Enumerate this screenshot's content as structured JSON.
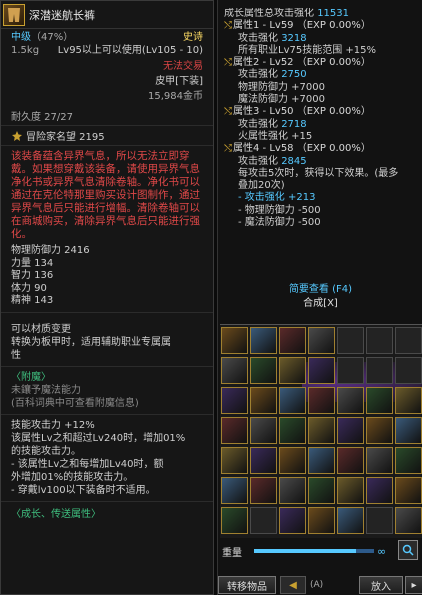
{
  "tooltip": {
    "item_name": "深潜迷航长裤",
    "grade": "中级",
    "grade_pct": "（47%）",
    "rarity": "史诗",
    "weight": "1.5kg",
    "level_req": "Lv95以上可以使用(Lv105 - 10)",
    "trade": "无法交易",
    "type": "皮甲[下装]",
    "price": "15,984金币",
    "durability": "耐久度 27/27",
    "fame": "冒险家名望 2195",
    "warning": "该装备蕴含异界气息，所以无法立即穿戴。如果想穿戴该装备，请使用异界气息净化书或异界气息清除卷轴。净化书可以通过在克伦特那里购买设计图制作，通过异界气息后只能进行增幅。清除卷轴可以在商城购买，清除异界气息后只能进行强化。",
    "stats": [
      "物理防御力 2416",
      "力量 134",
      "智力 136",
      "体力 90",
      "精神 143"
    ],
    "transfer": [
      "可以材质变更",
      "转换为板甲时，适用辅助职业专属属",
      "性"
    ],
    "enchant": [
      "〈附魔〉",
      "未鑲予魔法能力",
      "(百科词典中可查看附魔信息)"
    ],
    "skills": [
      "技能攻击力 +12%",
      "该属性Lv之和超过Lv240时，增加01%",
      "的技能攻击力。",
      " - 该属性Lv之和每增加Lv40时，额",
      "外增加01%的技能攻击力。",
      " - 穿戴lv100以下装备时不适用。"
    ],
    "footer": "〈成长、传送属性〉"
  },
  "growth": {
    "title": "成长属性总攻击强化",
    "title_value": "11531",
    "attrs": [
      {
        "head": "属性1 - Lv59 （EXP 0.00%）",
        "atk_label": "攻击强化",
        "atk": "3218",
        "lines": [
          "所有职业Lv75技能范围 +15%"
        ]
      },
      {
        "head": "属性2 - Lv52 （EXP 0.00%）",
        "atk_label": "攻击强化",
        "atk": "2750",
        "lines": [
          "物理防御力 +7000",
          "魔法防御力 +7000"
        ]
      },
      {
        "head": "属性3 - Lv50 （EXP 0.00%）",
        "atk_label": "攻击强化",
        "atk": "2718",
        "lines": [
          "火属性强化 +15"
        ]
      },
      {
        "head": "属性4 - Lv58 （EXP 0.00%）",
        "atk_label": "攻击强化",
        "atk": "2845",
        "lines": [
          "每攻击5次时，获得以下效果。(最多",
          "叠加20次)",
          "- 攻击强化 +213",
          "- 物理防御力 -500",
          "- 魔法防御力 -500"
        ]
      }
    ],
    "simple_view": "简要查看 (F4)",
    "merge": "合成[X]"
  },
  "inventory": {
    "weight_label": "重量",
    "weight_fill_pct": 0.85,
    "weight_end": "∞",
    "move_items": "转移物品",
    "slot_hint": "(A)",
    "put_in": "放入"
  },
  "colors": {
    "accent_gold": "#c8a030",
    "blue": "#56c9ff",
    "red": "#e04848",
    "green": "#3fbf7f"
  }
}
